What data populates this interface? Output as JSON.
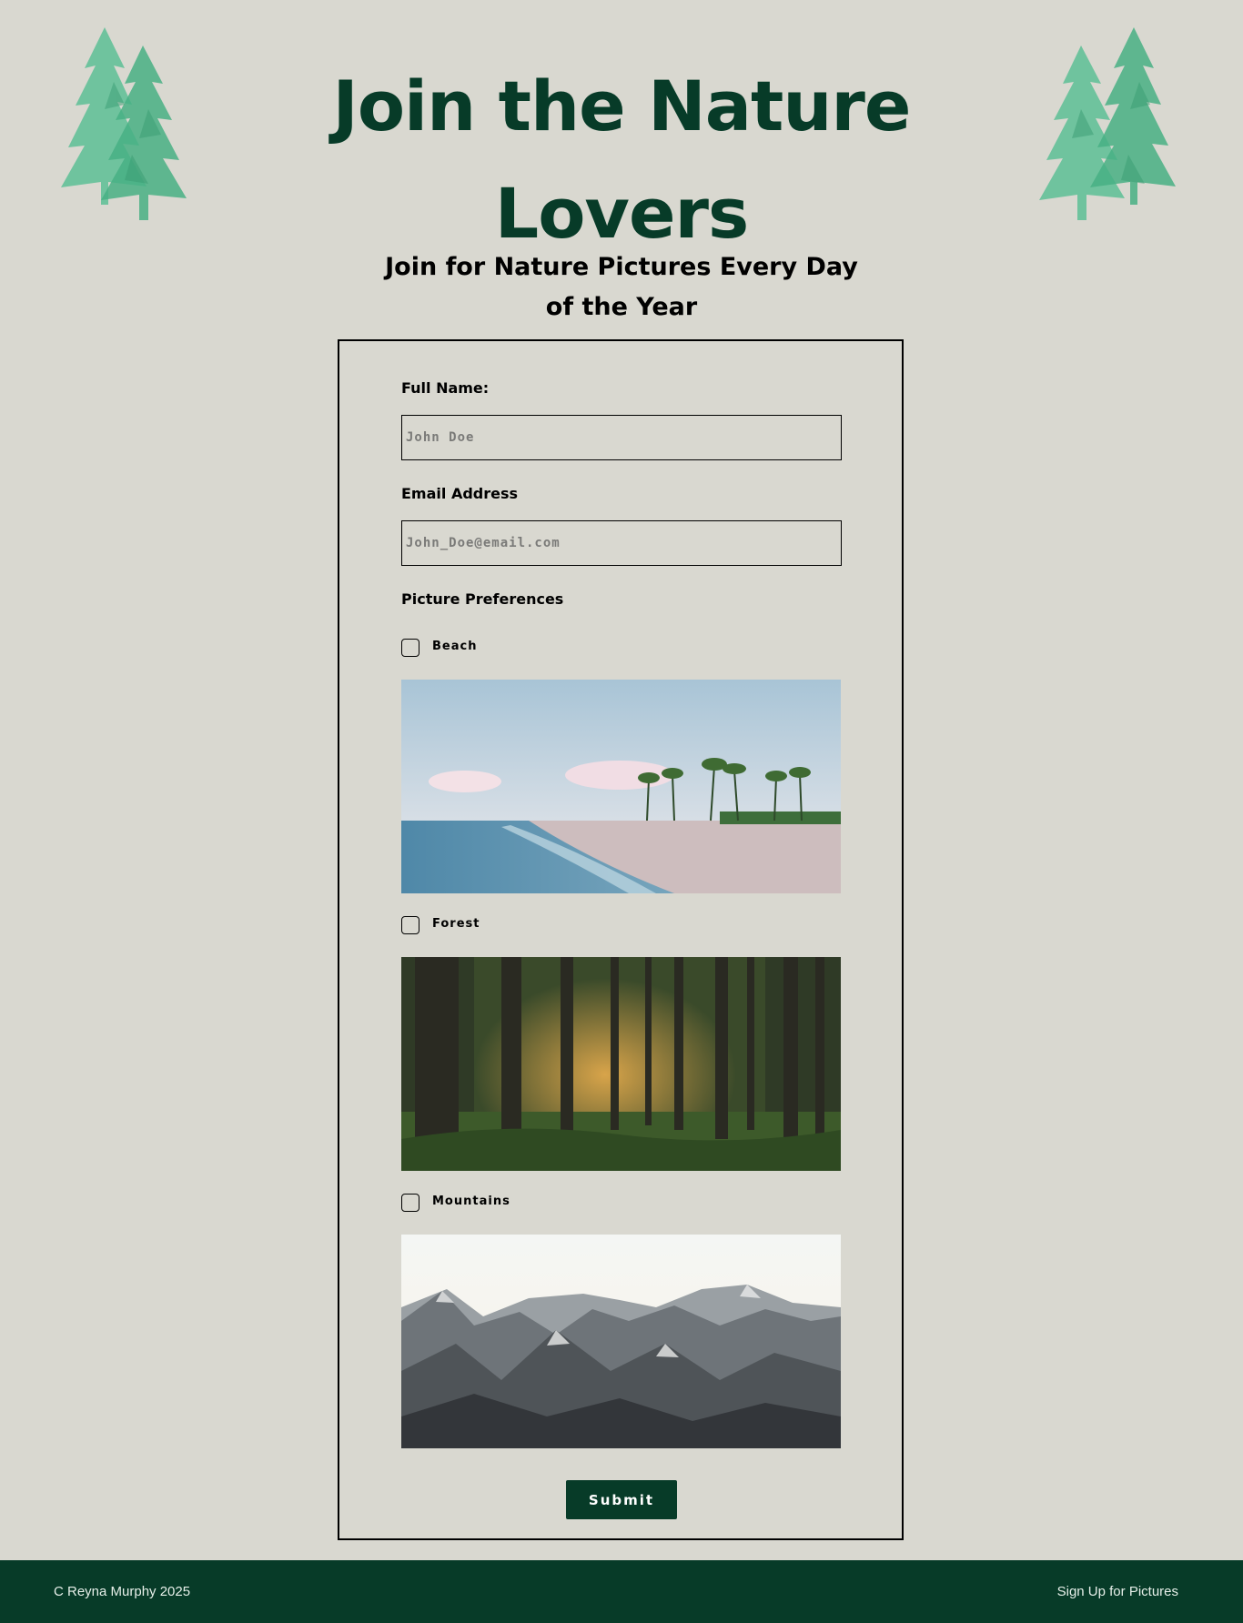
{
  "header": {
    "title": "Join the Nature Lovers",
    "subtitle": "Join for Nature Pictures Every Day of the Year"
  },
  "form": {
    "full_name": {
      "label": "Full Name:",
      "placeholder": "John Doe",
      "value": ""
    },
    "email": {
      "label": "Email Address",
      "placeholder": "John_Doe@email.com",
      "value": ""
    },
    "preferences": {
      "heading": "Picture Preferences",
      "options": [
        {
          "label": "Beach",
          "checked": false
        },
        {
          "label": "Forest",
          "checked": false
        },
        {
          "label": "Mountains",
          "checked": false
        }
      ]
    },
    "submit_label": "Submit"
  },
  "footer": {
    "copyright": "C Reyna Murphy 2025",
    "link_label": "Sign Up for Pictures"
  },
  "colors": {
    "background": "#d9d8d0",
    "brand_green": "#073b28",
    "tree_green": "#5cbf95"
  }
}
